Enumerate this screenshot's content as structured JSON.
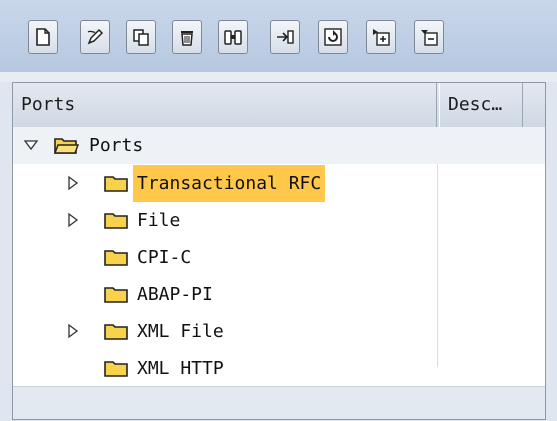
{
  "toolbar": {
    "buttons": [
      {
        "icon": "new-document-icon"
      },
      {
        "icon": "edit-pencil-icon"
      },
      {
        "icon": "copy-icon"
      },
      {
        "icon": "delete-trash-icon"
      },
      {
        "icon": "binoculars-find-icon"
      },
      {
        "icon": "transport-icon"
      },
      {
        "icon": "refresh-icon"
      },
      {
        "icon": "expand-subtree-icon"
      },
      {
        "icon": "collapse-subtree-icon"
      }
    ]
  },
  "tree": {
    "columns": [
      "Ports",
      "Desc…"
    ],
    "root": {
      "label": "Ports",
      "expanded": true
    },
    "items": [
      {
        "label": "Transactional RFC",
        "expandable": true,
        "selected": true
      },
      {
        "label": "File",
        "expandable": true,
        "selected": false
      },
      {
        "label": "CPI-C",
        "expandable": false,
        "selected": false
      },
      {
        "label": "ABAP-PI",
        "expandable": false,
        "selected": false
      },
      {
        "label": "XML File",
        "expandable": true,
        "selected": false
      },
      {
        "label": "XML HTTP",
        "expandable": false,
        "selected": false
      }
    ]
  },
  "colors": {
    "selection": "#ffc84a",
    "folder_fill": "#f7d24a",
    "toolbar_bg": "#c2d2e7"
  }
}
